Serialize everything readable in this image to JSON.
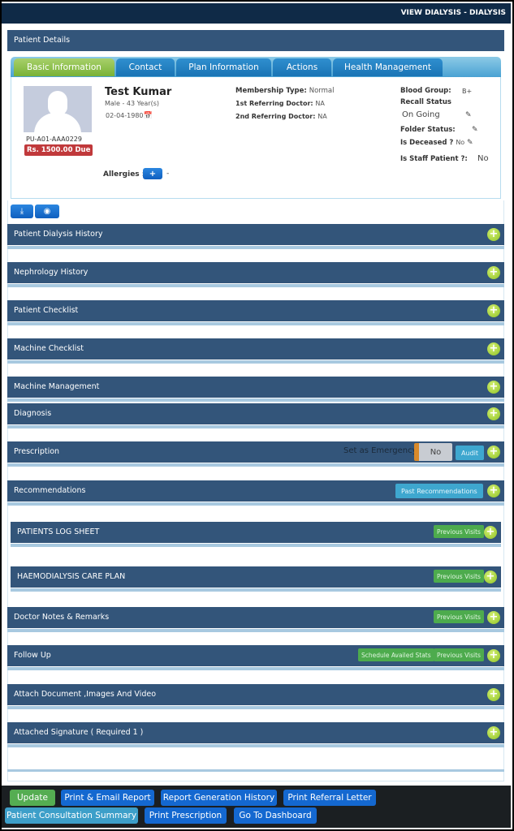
{
  "header": {
    "title": "VIEW DIALYSIS - DIALYSIS"
  },
  "patient_details": {
    "title": "Patient Details",
    "tabs": [
      {
        "label": "Basic Information",
        "active": true
      },
      {
        "label": "Contact",
        "active": false
      },
      {
        "label": "Plan Information",
        "active": false
      },
      {
        "label": "Actions",
        "active": false
      },
      {
        "label": "Health Management",
        "active": false
      }
    ],
    "name": "Test Kumar",
    "gender_age": "Male  -  43 Year(s)",
    "dob": "02-04-1980",
    "patient_id": "PU-A01-AAA0229",
    "due": "Rs. 1500.00 Due",
    "membership_label": "Membership Type:",
    "membership_value": "Normal",
    "ref1_label": "1st Referring Doctor:",
    "ref1_value": "NA",
    "ref2_label": "2nd Referring Doctor:",
    "ref2_value": "NA",
    "blood_group_label": "Blood Group:",
    "blood_group_value": "B+",
    "recall_label": "Recall Status",
    "recall_value": "On Going",
    "folder_label": "Folder Status:",
    "deceased_label": "Is Deceased ?",
    "deceased_value": "No",
    "staff_label": "Is Staff Patient ?:",
    "staff_value": "No",
    "allergies_label": "Allergies :",
    "allergies_add": "+",
    "allergies_value": "-"
  },
  "icons": {
    "download": "download-icon",
    "view": "eye-icon"
  },
  "sections": [
    {
      "title": "Patient Dialysis History"
    },
    {
      "title": "Nephrology History"
    },
    {
      "title": "Patient Checklist"
    },
    {
      "title": "Machine Checklist"
    },
    {
      "title": "Machine Management"
    },
    {
      "title": "Diagnosis"
    },
    {
      "title": "Prescription",
      "emergency_label": "Set as Emergency",
      "emergency_value": "No",
      "audit": "Audit"
    },
    {
      "title": "Recommendations",
      "button": "Past Recommendations"
    },
    {
      "title": "PATIENTS LOG SHEET",
      "button": "Previous Visits"
    },
    {
      "title": "HAEMODIALYSIS CARE PLAN",
      "button": "Previous Visits"
    },
    {
      "title": "Doctor Notes & Remarks",
      "button": "Previous Visits"
    },
    {
      "title": "Follow Up",
      "button2": "Schedule Availed Stats",
      "button": "Previous Visits"
    },
    {
      "title": "Attach Document ,Images And Video"
    },
    {
      "title": "Attached Signature ( Required 1 )"
    }
  ],
  "footer": {
    "update": "Update",
    "print_email": "Print & Email Report",
    "report_history": "Report Generation History",
    "referral": "Print Referral Letter",
    "consultation": "Patient Consultation Summary",
    "prescription": "Print Prescription",
    "dashboard": "Go To Dashboard"
  }
}
